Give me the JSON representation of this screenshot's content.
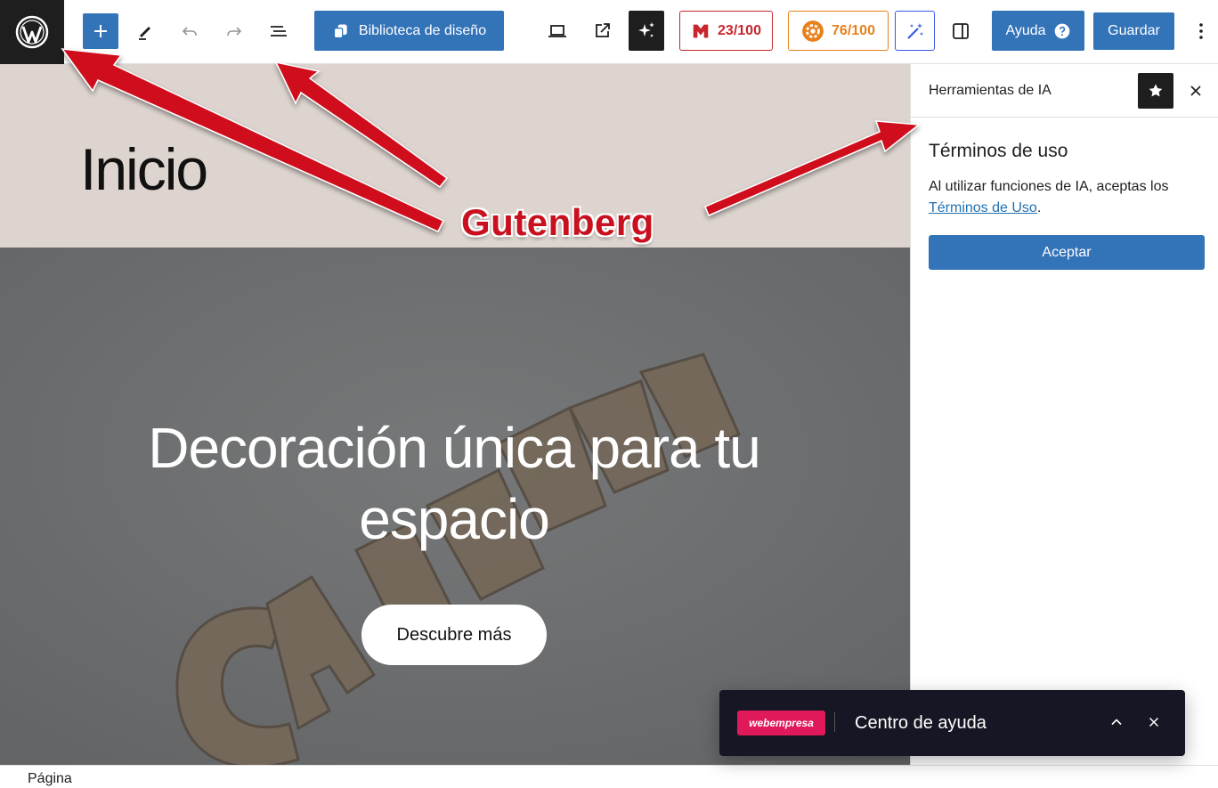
{
  "toolbar": {
    "design_library_label": "Biblioteca de diseño",
    "score_red": "23/100",
    "score_orange": "76/100",
    "help_label": "Ayuda",
    "save_label": "Guardar"
  },
  "canvas": {
    "page_title": "Inicio",
    "hero_heading": "Decoración única para tu espacio",
    "hero_cta": "Descubre más"
  },
  "sidebar": {
    "title": "Herramientas de IA",
    "heading": "Términos de uso",
    "text_prefix": "Al utilizar funciones de IA, aceptas los ",
    "link_text": "Términos de Uso",
    "text_suffix": ".",
    "accept_label": "Aceptar"
  },
  "footer": {
    "breadcrumb": "Página"
  },
  "help_widget": {
    "logo_text": "webempresa",
    "title": "Centro de ayuda"
  },
  "annotation": {
    "label": "Gutenberg"
  },
  "colors": {
    "wp_blue": "#3373b8",
    "score_red": "#c9252d",
    "score_orange": "#e7811c",
    "annotation_red": "#c8101e",
    "title_bg": "#ddd4cf"
  }
}
